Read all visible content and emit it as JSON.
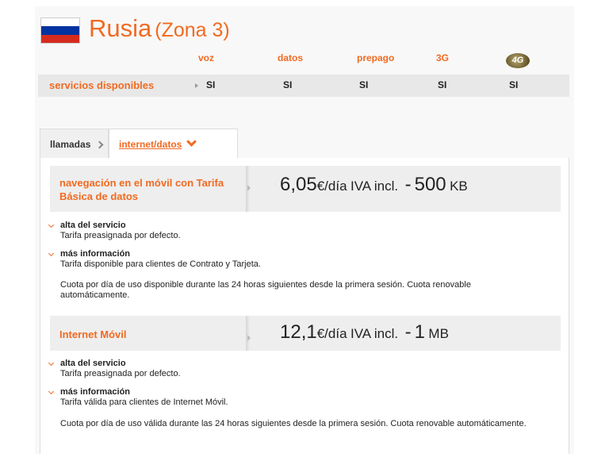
{
  "header": {
    "country": "Rusia",
    "zone": "(Zona 3)"
  },
  "services": {
    "columns": [
      "voz",
      "datos",
      "prepago",
      "3G",
      "4G"
    ],
    "row_label": "servicios disponibles",
    "values": [
      "SI",
      "SI",
      "SI",
      "SI",
      "SI"
    ]
  },
  "tabs": {
    "calls": "llamadas",
    "data": "internet/datos"
  },
  "plans": [
    {
      "name": "navegación en el móvil con Tarifa Básica de datos",
      "price": "6,05",
      "unit": "€/día",
      "tax": "IVA incl.",
      "dash": "-",
      "amount": "500",
      "amount_unit": "KB",
      "alta_title": "alta del servicio",
      "alta_desc": "Tarifa preasignada por defecto.",
      "info_title": "más información",
      "info_desc": "Tarifa disponible para clientes de Contrato y Tarjeta.",
      "note": "Cuota por día de uso disponible durante las 24 horas siguientes desde la primera sesión. Cuota renovable automáticamente."
    },
    {
      "name": "Internet Móvil",
      "price": "12,1",
      "unit": "€/día",
      "tax": "IVA incl.",
      "dash": "-",
      "amount": "1",
      "amount_unit": "MB",
      "alta_title": "alta del servicio",
      "alta_desc": "Tarifa preasignada por defecto.",
      "info_title": "más información",
      "info_desc": "Tarifa válida para clientes de Internet Móvil.",
      "note": "Cuota por día de uso válida durante las 24 horas siguientes desde la primera sesión. Cuota renovable automáticamente."
    }
  ],
  "colors": {
    "accent": "#f26a21",
    "row_bg": "#e8e8e8"
  },
  "icons": {
    "flag": "russia-flag-icon",
    "badge": "4g-badge-icon"
  }
}
